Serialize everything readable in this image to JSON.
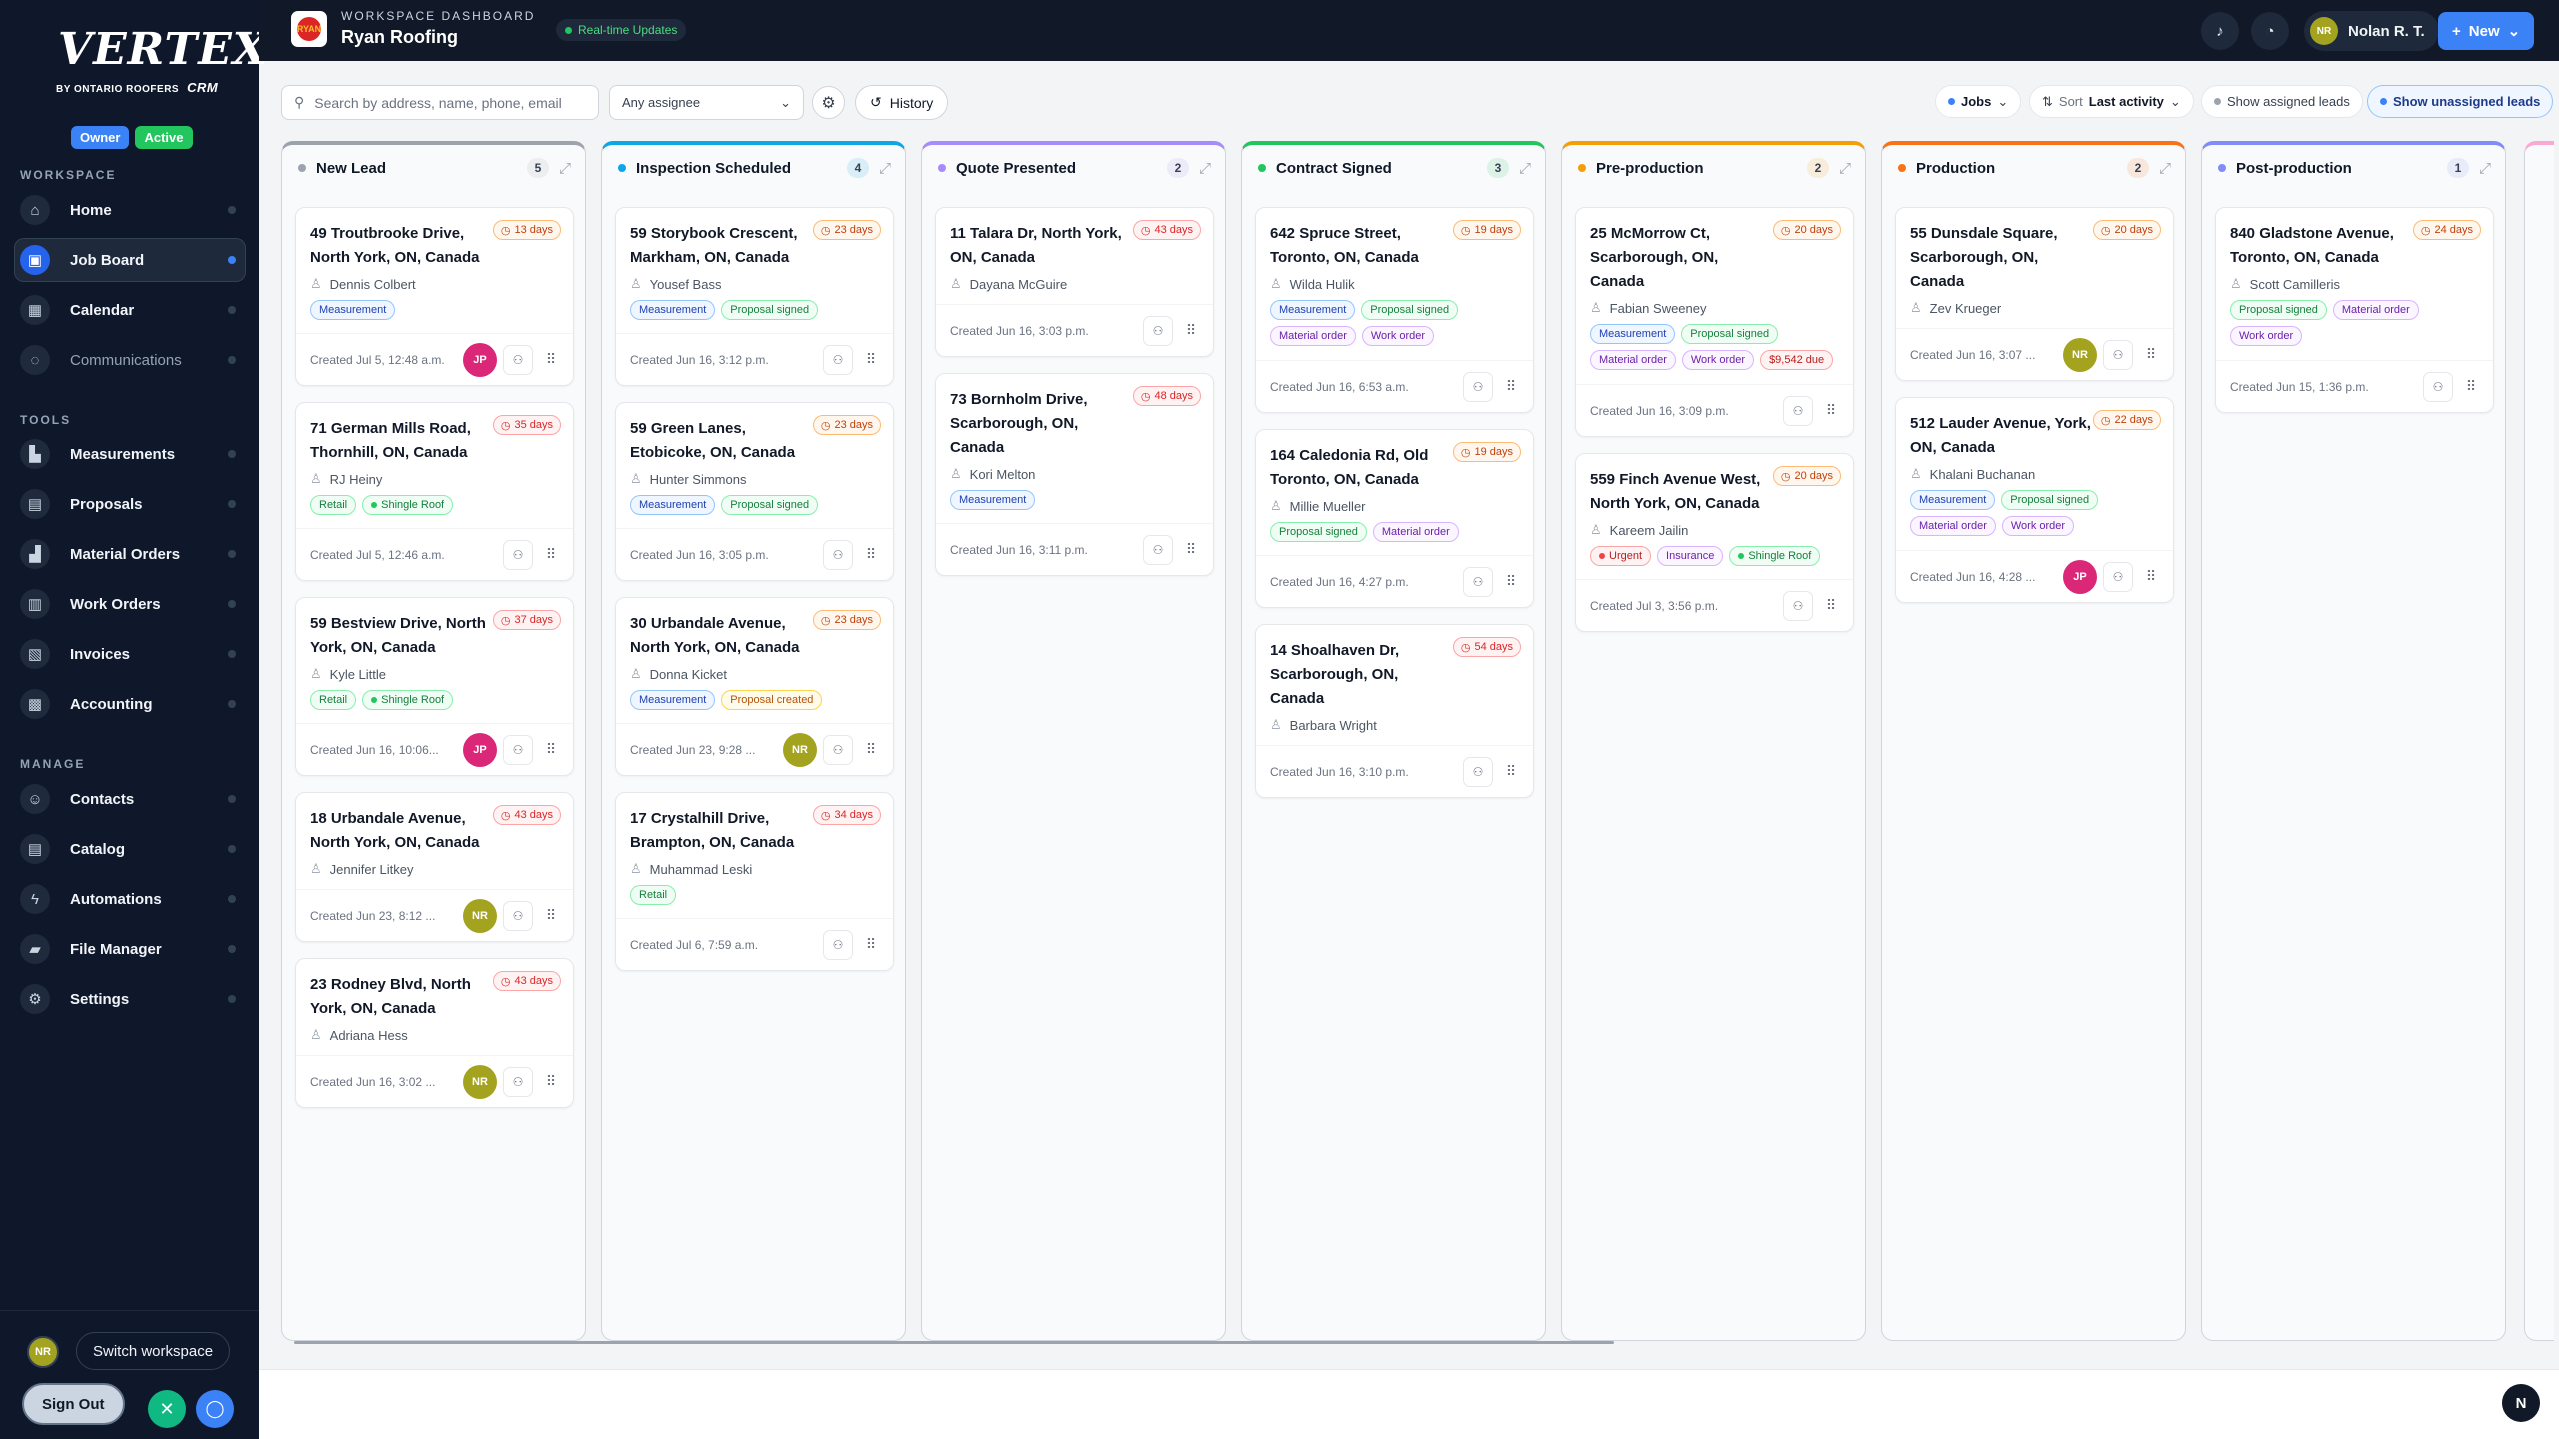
{
  "sidebar": {
    "logo": {
      "main": "VERTEX",
      "by": "BY ONTARIO ROOFERS",
      "crm": "CRM"
    },
    "badges": {
      "owner": "Owner",
      "active": "Active"
    },
    "sections": {
      "workspace": "WORKSPACE",
      "tools": "TOOLS",
      "manage": "MANAGE"
    },
    "workspace_items": [
      "Home",
      "Job Board",
      "Calendar",
      "Communications"
    ],
    "tools_items": [
      "Measurements",
      "Proposals",
      "Material Orders",
      "Work Orders",
      "Invoices",
      "Accounting"
    ],
    "manage_items": [
      "Contacts",
      "Catalog",
      "Automations",
      "File Manager",
      "Settings"
    ],
    "user_initials": "NR",
    "switch_workspace": "Switch workspace",
    "sign_out": "Sign Out"
  },
  "topbar": {
    "workspace_label": "WORKSPACE DASHBOARD",
    "workspace_name": "Ryan Roofing",
    "logo_text": "RYAN",
    "realtime": "Real-time Updates",
    "user_initials": "NR",
    "user_name": "Nolan R. T.",
    "new_label": "New"
  },
  "toolbar": {
    "search_placeholder": "Search by address, name, phone, email",
    "assignee": "Any assignee",
    "history": "History",
    "jobs": "Jobs",
    "sort_label": "Sort",
    "sort_value": "Last activity",
    "show_assigned": "Show assigned leads",
    "show_unassigned": "Show unassigned leads"
  },
  "columns": [
    {
      "name": "New Lead",
      "count": "5",
      "color": "#9ca3af",
      "cards": [
        {
          "address": "49 Troutbrooke Drive, North York, ON, Canada",
          "days": "13 days",
          "days_style": "orange",
          "contact": "Dennis Colbert",
          "tags": [
            {
              "label": "Measurement",
              "style": "blue"
            }
          ],
          "created": "Created Jul 5, 12:48 a.m.",
          "avatar": "JP"
        },
        {
          "address": "71 German Mills Road, Thornhill, ON, Canada",
          "days": "35 days",
          "days_style": "red",
          "contact": "RJ Heiny",
          "tags": [
            {
              "label": "Retail",
              "style": "green"
            },
            {
              "label": "Shingle Roof",
              "style": "green",
              "dot": true
            }
          ],
          "created": "Created Jul 5, 12:46 a.m.",
          "avatar": ""
        },
        {
          "address": "59 Bestview Drive, North York, ON, Canada",
          "days": "37 days",
          "days_style": "red",
          "contact": "Kyle Little",
          "tags": [
            {
              "label": "Retail",
              "style": "green"
            },
            {
              "label": "Shingle Roof",
              "style": "green",
              "dot": true
            }
          ],
          "created": "Created Jun 16, 10:06...",
          "avatar": "JP"
        },
        {
          "address": "18 Urbandale Avenue, North York, ON, Canada",
          "days": "43 days",
          "days_style": "red",
          "contact": "Jennifer Litkey",
          "tags": [],
          "created": "Created Jun 23, 8:12 ...",
          "avatar": "NR"
        },
        {
          "address": "23 Rodney Blvd, North York, ON, Canada",
          "days": "43 days",
          "days_style": "red",
          "contact": "Adriana Hess",
          "tags": [],
          "created": "Created Jun 16, 3:02 ...",
          "avatar": "NR"
        }
      ]
    },
    {
      "name": "Inspection Scheduled",
      "count": "4",
      "color": "#0ea5e9",
      "cards": [
        {
          "address": "59 Storybook Crescent, Markham, ON, Canada",
          "days": "23 days",
          "days_style": "orange",
          "contact": "Yousef Bass",
          "tags": [
            {
              "label": "Measurement",
              "style": "blue"
            },
            {
              "label": "Proposal signed",
              "style": "green"
            }
          ],
          "created": "Created Jun 16, 3:12 p.m.",
          "avatar": ""
        },
        {
          "address": "59 Green Lanes, Etobicoke, ON, Canada",
          "days": "23 days",
          "days_style": "orange",
          "contact": "Hunter Simmons",
          "tags": [
            {
              "label": "Measurement",
              "style": "blue"
            },
            {
              "label": "Proposal signed",
              "style": "green"
            }
          ],
          "created": "Created Jun 16, 3:05 p.m.",
          "avatar": ""
        },
        {
          "address": "30 Urbandale Avenue, North York, ON, Canada",
          "days": "23 days",
          "days_style": "orange",
          "contact": "Donna Kicket",
          "tags": [
            {
              "label": "Measurement",
              "style": "blue"
            },
            {
              "label": "Proposal created",
              "style": "amber"
            }
          ],
          "created": "Created Jun 23, 9:28 ...",
          "avatar": "NR"
        },
        {
          "address": "17 Crystalhill Drive, Brampton, ON, Canada",
          "days": "34 days",
          "days_style": "red",
          "contact": "Muhammad Leski",
          "tags": [
            {
              "label": "Retail",
              "style": "green"
            }
          ],
          "created": "Created Jul 6, 7:59 a.m.",
          "avatar": ""
        }
      ]
    },
    {
      "name": "Quote Presented",
      "count": "2",
      "color": "#a78bfa",
      "cards": [
        {
          "address": "11 Talara Dr, North York, ON, Canada",
          "days": "43 days",
          "days_style": "red",
          "contact": "Dayana McGuire",
          "tags": [],
          "created": "Created Jun 16, 3:03 p.m.",
          "avatar": ""
        },
        {
          "address": "73 Bornholm Drive, Scarborough, ON, Canada",
          "days": "48 days",
          "days_style": "red",
          "contact": "Kori Melton",
          "tags": [
            {
              "label": "Measurement",
              "style": "blue"
            }
          ],
          "created": "Created Jun 16, 3:11 p.m.",
          "avatar": ""
        }
      ]
    },
    {
      "name": "Contract Signed",
      "count": "3",
      "color": "#22c55e",
      "cards": [
        {
          "address": "642 Spruce Street, Toronto, ON, Canada",
          "days": "19 days",
          "days_style": "orange",
          "contact": "Wilda Hulik",
          "tags": [
            {
              "label": "Measurement",
              "style": "blue"
            },
            {
              "label": "Proposal signed",
              "style": "green"
            },
            {
              "label": "Material order",
              "style": "purple"
            },
            {
              "label": "Work order",
              "style": "purple"
            }
          ],
          "created": "Created Jun 16, 6:53 a.m.",
          "avatar": ""
        },
        {
          "address": "164 Caledonia Rd, Old Toronto, ON, Canada",
          "days": "19 days",
          "days_style": "orange",
          "contact": "Millie Mueller",
          "tags": [
            {
              "label": "Proposal signed",
              "style": "green"
            },
            {
              "label": "Material order",
              "style": "purple"
            }
          ],
          "created": "Created Jun 16, 4:27 p.m.",
          "avatar": ""
        },
        {
          "address": "14 Shoalhaven Dr, Scarborough, ON, Canada",
          "days": "54 days",
          "days_style": "red",
          "contact": "Barbara Wright",
          "tags": [],
          "created": "Created Jun 16, 3:10 p.m.",
          "avatar": ""
        }
      ]
    },
    {
      "name": "Pre-production",
      "count": "2",
      "color": "#f59e0b",
      "cards": [
        {
          "address": "25 McMorrow Ct, Scarborough, ON, Canada",
          "days": "20 days",
          "days_style": "orange",
          "contact": "Fabian Sweeney",
          "tags": [
            {
              "label": "Measurement",
              "style": "blue"
            },
            {
              "label": "Proposal signed",
              "style": "green"
            },
            {
              "label": "Material order",
              "style": "purple"
            },
            {
              "label": "Work order",
              "style": "purple"
            },
            {
              "label": "$9,542 due",
              "style": "redtag"
            }
          ],
          "created": "Created Jun 16, 3:09 p.m.",
          "avatar": ""
        },
        {
          "address": "559 Finch Avenue West, North York, ON, Canada",
          "days": "20 days",
          "days_style": "orange",
          "contact": "Kareem Jailin",
          "tags": [
            {
              "label": "Urgent",
              "style": "redtag",
              "dot": true
            },
            {
              "label": "Insurance",
              "style": "purple"
            },
            {
              "label": "Shingle Roof",
              "style": "green",
              "dot": true
            }
          ],
          "created": "Created Jul 3, 3:56 p.m.",
          "avatar": ""
        }
      ]
    },
    {
      "name": "Production",
      "count": "2",
      "color": "#f97316",
      "cards": [
        {
          "address": "55 Dunsdale Square, Scarborough, ON, Canada",
          "days": "20 days",
          "days_style": "orange",
          "contact": "Zev Krueger",
          "tags": [],
          "created": "Created Jun 16, 3:07 ...",
          "avatar": "NR"
        },
        {
          "address": "512 Lauder Avenue, York, ON, Canada",
          "days": "22 days",
          "days_style": "orange",
          "contact": "Khalani Buchanan",
          "tags": [
            {
              "label": "Measurement",
              "style": "blue"
            },
            {
              "label": "Proposal signed",
              "style": "green"
            },
            {
              "label": "Material order",
              "style": "purple"
            },
            {
              "label": "Work order",
              "style": "purple"
            }
          ],
          "created": "Created Jun 16, 4:28 ...",
          "avatar": "JP"
        }
      ]
    },
    {
      "name": "Post-production",
      "count": "1",
      "color": "#818cf8",
      "cards": [
        {
          "address": "840 Gladstone Avenue, Toronto, ON, Canada",
          "days": "24 days",
          "days_style": "orange",
          "contact": "Scott Camilleris",
          "tags": [
            {
              "label": "Proposal signed",
              "style": "green"
            },
            {
              "label": "Material order",
              "style": "purple"
            },
            {
              "label": "Work order",
              "style": "purple"
            }
          ],
          "created": "Created Jun 15, 1:36 p.m.",
          "avatar": ""
        }
      ]
    }
  ],
  "corner_button": "N"
}
